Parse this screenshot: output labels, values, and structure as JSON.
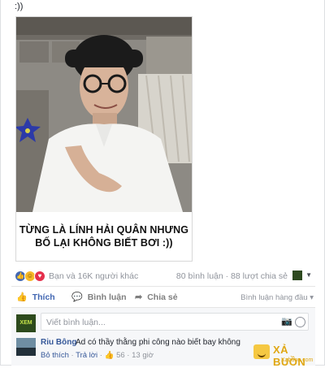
{
  "post": {
    "caption": ":))",
    "meme_text_line1": "TỪNG LÀ LÍNH HẢI QUÂN NHƯNG",
    "meme_text_line2": "BỐ LẠI KHÔNG BIẾT BƠI :))"
  },
  "stats": {
    "reaction_summary": "Bạn và 16K người khác",
    "comments_shares": "80 bình luận · 88 lượt chia sẻ"
  },
  "actions": {
    "like_label": "Thích",
    "comment_label": "Bình luận",
    "share_label": "Chia sẻ",
    "sort_label": "Bình luận hàng đầu ▾"
  },
  "comment_input": {
    "placeholder": "Viết bình luận..."
  },
  "comments": [
    {
      "author": "Riu Bông",
      "text": "Ad có thầy thằng phi công nào biết bay không",
      "unlike_label": "Bỏ thích",
      "reply_label": "Trả lời",
      "like_count": "56",
      "time": "13 giờ"
    }
  ],
  "watermark": {
    "brand": "XẢ BUỒN",
    "site": "Xabuon.com"
  },
  "icons": {
    "my_avatar_text": "XEM",
    "camera": "📷",
    "thumb": "👍",
    "comment": "💬",
    "share": "➦"
  },
  "colors": {
    "facebook_blue": "#4267b2",
    "link": "#365899",
    "muted": "#90949c"
  }
}
